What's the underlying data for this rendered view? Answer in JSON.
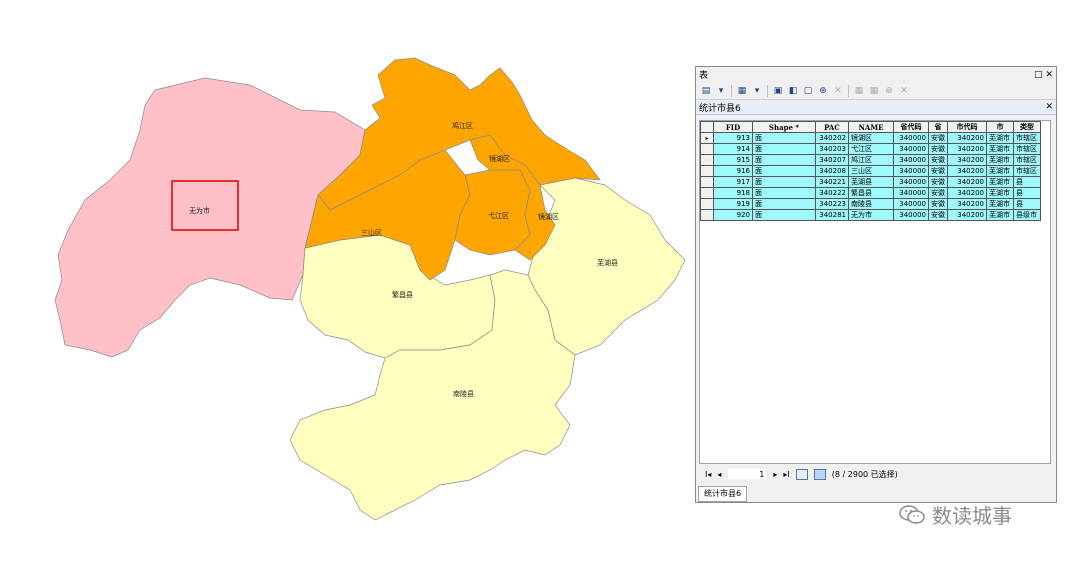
{
  "map": {
    "labels": {
      "wuwei": "无为市",
      "jiujiang": "鸠江区",
      "jinghu": "镜湖区",
      "yijiang": "弋江区",
      "sanshan": "三山区",
      "fanchang": "繁昌县",
      "nanling": "南陵县",
      "wuhu_county": "芜湖县"
    },
    "colors": {
      "wuwei_fill": "#ffc0c7",
      "urban_fill": "#ffa500",
      "county_fill": "#ffffc0",
      "highlight_box": "#e00000"
    }
  },
  "window": {
    "title": "表",
    "tab_title": "统计市县6",
    "columns": [
      "FID",
      "Shape *",
      "PAC",
      "NAME",
      "省代码",
      "省",
      "市代码",
      "市",
      "类型"
    ],
    "rows": [
      [
        "913",
        "面",
        "340202",
        "镜湖区",
        "340000",
        "安徽",
        "340200",
        "芜湖市",
        "市辖区"
      ],
      [
        "914",
        "面",
        "340203",
        "弋江区",
        "340000",
        "安徽",
        "340200",
        "芜湖市",
        "市辖区"
      ],
      [
        "915",
        "面",
        "340207",
        "鸠江区",
        "340000",
        "安徽",
        "340200",
        "芜湖市",
        "市辖区"
      ],
      [
        "916",
        "面",
        "340208",
        "三山区",
        "340000",
        "安徽",
        "340200",
        "芜湖市",
        "市辖区"
      ],
      [
        "917",
        "面",
        "340221",
        "芜湖县",
        "340000",
        "安徽",
        "340200",
        "芜湖市",
        "县"
      ],
      [
        "918",
        "面",
        "340222",
        "繁昌县",
        "340000",
        "安徽",
        "340200",
        "芜湖市",
        "县"
      ],
      [
        "919",
        "面",
        "340223",
        "南陵县",
        "340000",
        "安徽",
        "340200",
        "芜湖市",
        "县"
      ],
      [
        "920",
        "面",
        "340281",
        "无为市",
        "340000",
        "安徽",
        "340200",
        "芜湖市",
        "县级市"
      ]
    ],
    "current_row_marker": "▸",
    "nav": {
      "first": "I◂",
      "prev": "◂",
      "page": "1",
      "next": "▸",
      "last": "▸I",
      "selection_status": "(8 / 2900 已选择)"
    },
    "bottom_tab": "统计市县6"
  },
  "watermark": {
    "text": "数读城事"
  }
}
